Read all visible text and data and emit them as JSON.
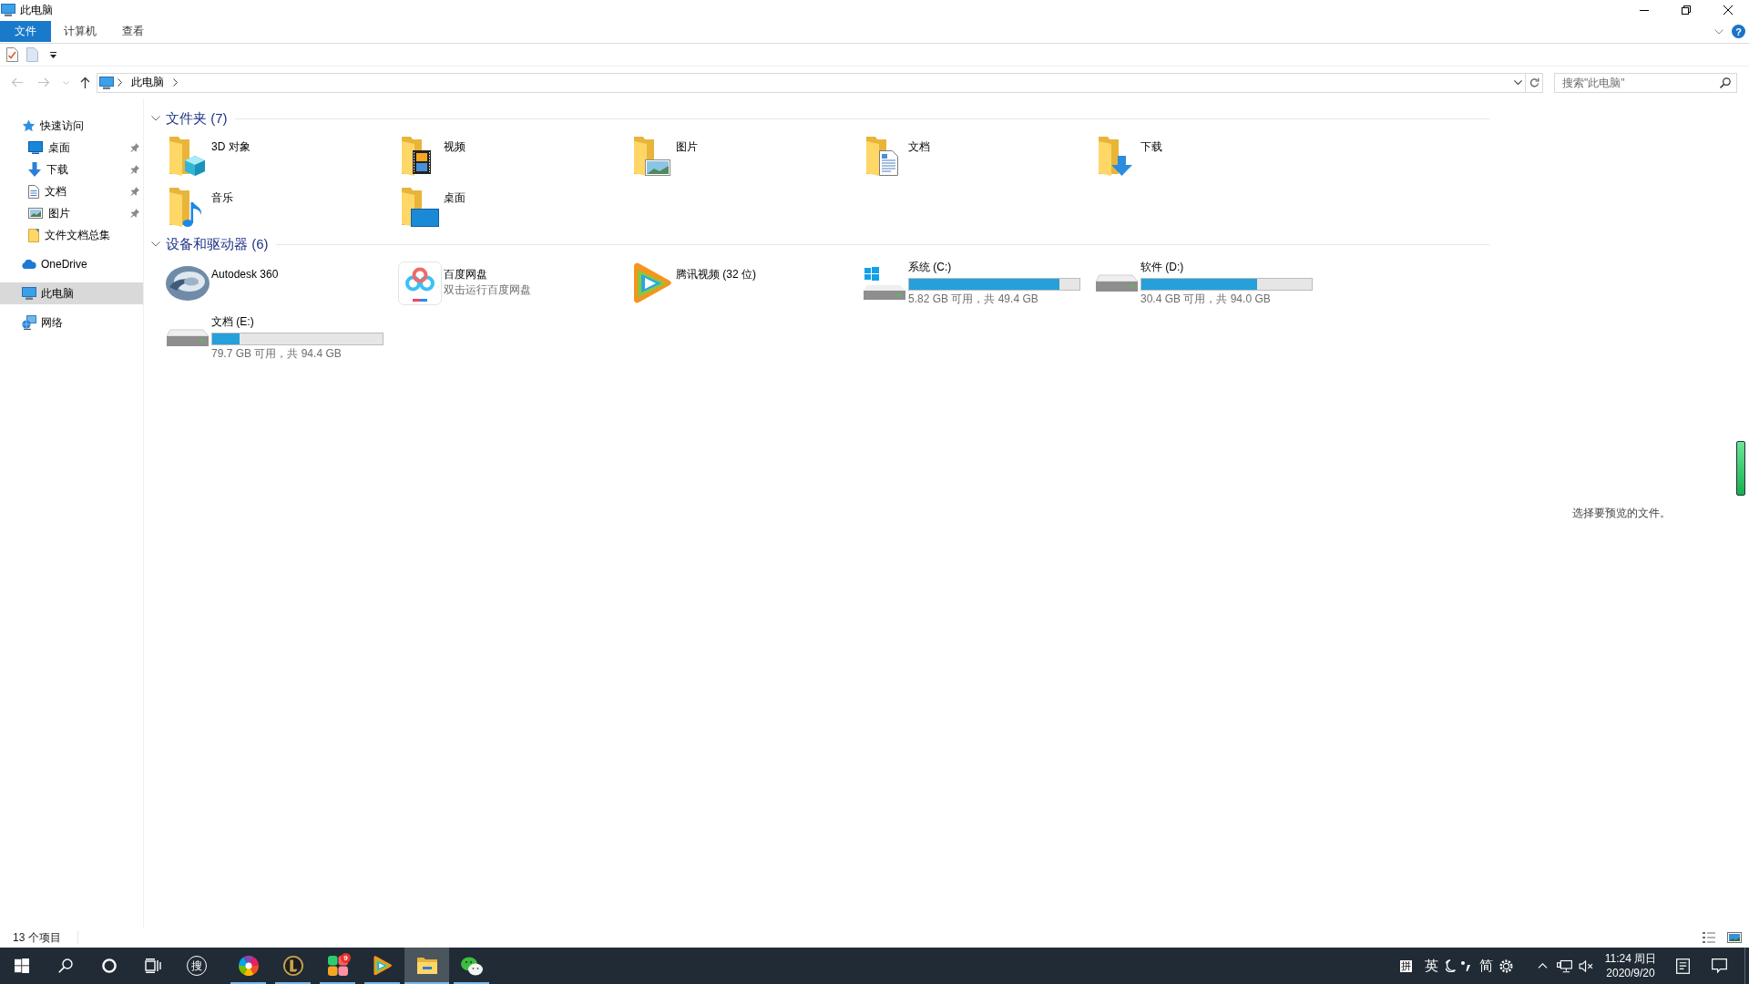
{
  "window": {
    "title": "此电脑"
  },
  "ribbon": {
    "tabs": [
      {
        "label": "文件",
        "selected": true
      },
      {
        "label": "计算机",
        "selected": false
      },
      {
        "label": "查看",
        "selected": false
      }
    ],
    "help": "?"
  },
  "navigation": [
    {
      "kind": "back",
      "disabled": true
    },
    {
      "kind": "forward",
      "disabled": true
    },
    {
      "kind": "recent",
      "disabled": true
    },
    {
      "kind": "up",
      "disabled": false
    }
  ],
  "address_bar": {
    "path": [
      "此电脑"
    ]
  },
  "search": {
    "placeholder": "搜索\"此电脑\""
  },
  "sidebar": {
    "items": [
      {
        "label": "快速访问",
        "kind": "star",
        "selected": false,
        "children": [
          {
            "label": "桌面",
            "kind": "desktop",
            "pinned": true,
            "selected": false
          },
          {
            "label": "下载",
            "kind": "downloads",
            "pinned": true,
            "selected": false
          },
          {
            "label": "文档",
            "kind": "documents",
            "pinned": true,
            "selected": false
          },
          {
            "label": "图片",
            "kind": "pictures",
            "pinned": true,
            "selected": false
          },
          {
            "label": "文件文档总集",
            "kind": "folder",
            "pinned": false,
            "selected": false
          }
        ]
      },
      {
        "label": "OneDrive",
        "kind": "cloud",
        "selected": false
      },
      {
        "label": "此电脑",
        "kind": "computer",
        "selected": true
      },
      {
        "label": "网络",
        "kind": "network",
        "selected": false
      }
    ]
  },
  "sections": [
    {
      "title": "文件夹 (7)",
      "expanded": true,
      "items": [
        {
          "name": "3D 对象",
          "kind": "objects"
        },
        {
          "name": "视频",
          "kind": "videos"
        },
        {
          "name": "图片",
          "kind": "pictures"
        },
        {
          "name": "文档",
          "kind": "documents"
        },
        {
          "name": "下载",
          "kind": "downloads"
        },
        {
          "name": "音乐",
          "kind": "music"
        },
        {
          "name": "桌面",
          "kind": "desktop"
        }
      ]
    },
    {
      "title": "设备和驱动器 (6)",
      "expanded": true,
      "items": [
        {
          "name": "Autodesk 360",
          "kind": "swirl"
        },
        {
          "name": "百度网盘",
          "detail": "双击运行百度网盘",
          "kind": "cloudapp"
        },
        {
          "name": "腾讯视频 (32 位)",
          "kind": "player"
        },
        {
          "name": "系统 (C:)",
          "kind": "system_drive",
          "level": 0.88,
          "detail": "5.82 GB 可用，共 49.4 GB"
        },
        {
          "name": "软件 (D:)",
          "kind": "drive",
          "level": 0.68,
          "detail": "30.4 GB 可用，共 94.0 GB"
        },
        {
          "name": "文档 (E:)",
          "kind": "drive",
          "level": 0.16,
          "detail": "79.7 GB 可用，共 94.4 GB"
        }
      ]
    }
  ],
  "preview": {
    "message": "选择要预览的文件。"
  },
  "status_bar": {
    "item_count": "13 个项目"
  },
  "taskbar": {
    "tools": [
      {
        "kind": "start"
      },
      {
        "kind": "search"
      },
      {
        "kind": "cortana"
      },
      {
        "kind": "task_view"
      },
      {
        "kind": "sogou",
        "glyph": "搜"
      }
    ],
    "apps": [
      {
        "kind": "pinwheel",
        "running": true,
        "active": false
      },
      {
        "kind": "league",
        "running": true,
        "active": false
      },
      {
        "kind": "tiles",
        "badge": "9",
        "running": true,
        "active": false
      },
      {
        "kind": "player",
        "running": true,
        "active": false
      },
      {
        "kind": "explorer",
        "running": true,
        "active": true
      },
      {
        "kind": "wechat",
        "running": true,
        "active": false
      }
    ],
    "ime": [
      {
        "kind": "boxed",
        "text": "拼"
      },
      {
        "kind": "text",
        "text": "英"
      },
      {
        "kind": "moon"
      },
      {
        "kind": "punctuation"
      },
      {
        "kind": "text",
        "text": "简"
      },
      {
        "kind": "gear"
      }
    ],
    "tray": {
      "volume_muted": true
    },
    "clock": {
      "time": "11:24 周日",
      "date": "2020/9/20"
    }
  }
}
